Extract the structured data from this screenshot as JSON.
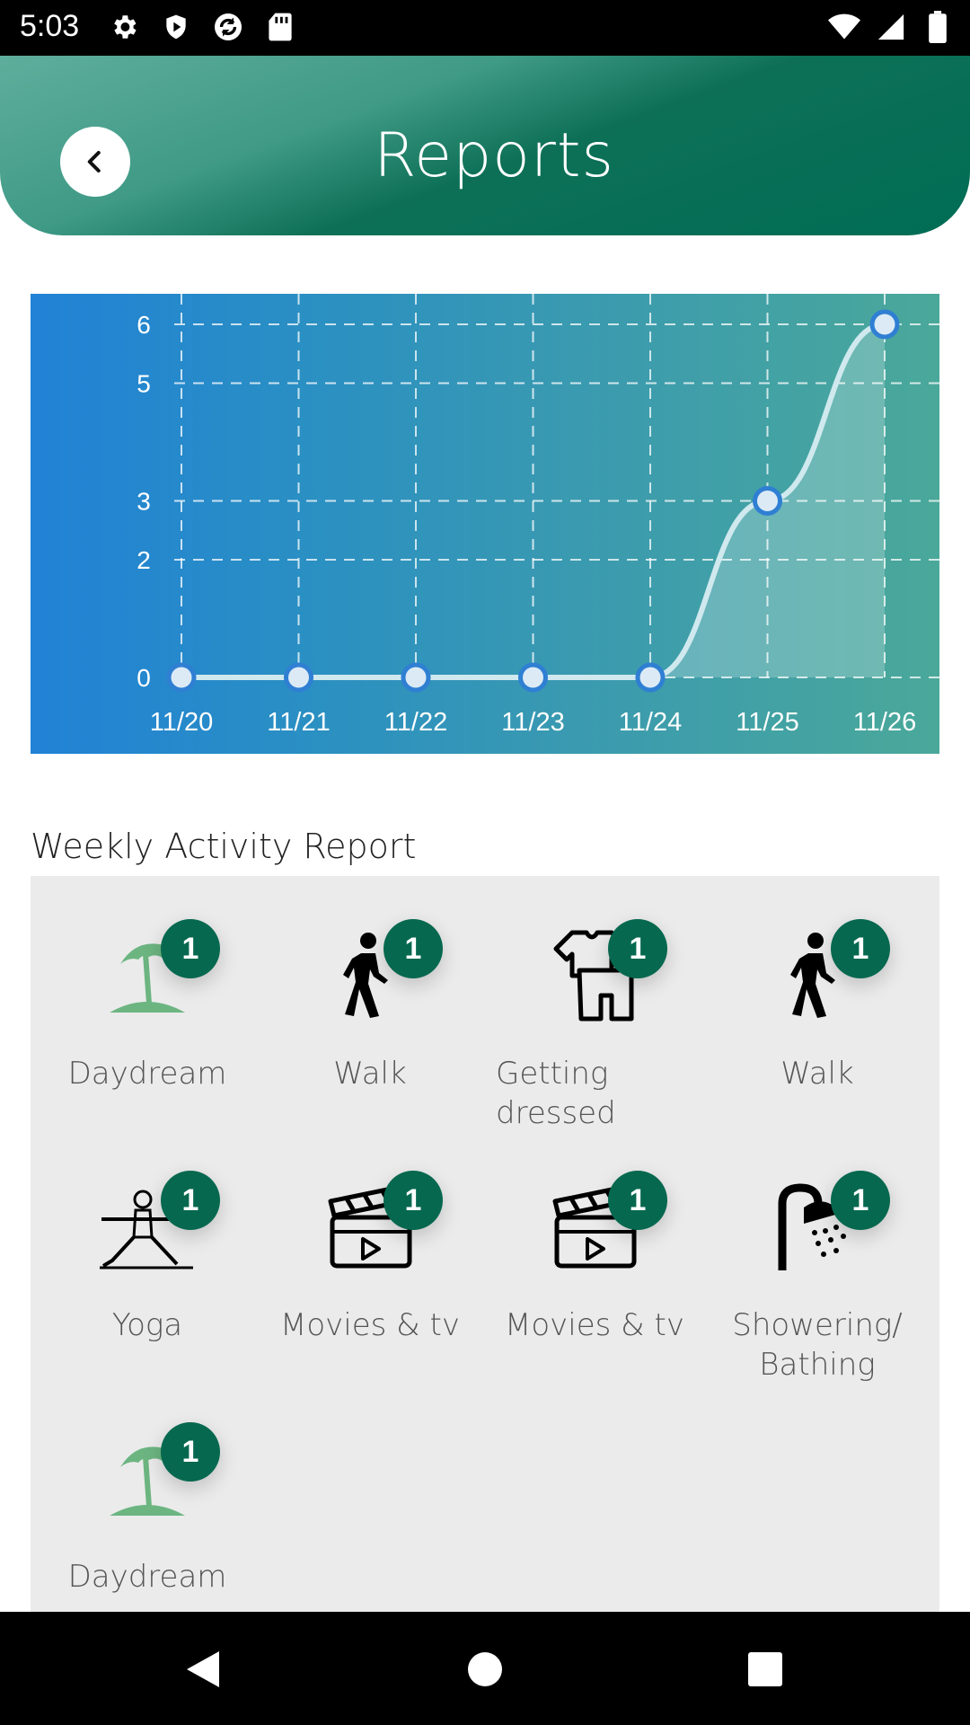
{
  "status_bar": {
    "time": "5:03",
    "icons_left": [
      "gear-icon",
      "shield-play-icon",
      "sync-icon",
      "sd-card-icon"
    ],
    "icons_right": [
      "wifi-icon",
      "signal-icon",
      "battery-icon"
    ]
  },
  "header": {
    "title": "Reports",
    "back_icon": "chevron-left-icon",
    "gradient_colors": [
      "#5fae9c",
      "#006d55"
    ]
  },
  "chart_data": {
    "type": "line",
    "x": [
      "11/20",
      "11/21",
      "11/22",
      "11/23",
      "11/24",
      "11/25",
      "11/26"
    ],
    "series": [
      {
        "values": [
          0,
          0,
          0,
          0,
          0,
          3,
          6
        ]
      }
    ],
    "yticks": [
      "6",
      "5",
      "3",
      "2",
      "0"
    ],
    "ylim": [
      0,
      6
    ],
    "grid": true,
    "smooth": true,
    "area_fill": true,
    "background_gradient": [
      "#2182d6",
      "#4aa89a"
    ],
    "line_color": "#cfe9ee",
    "marker_color": "#2f7fd3"
  },
  "weekly_report": {
    "title": "Weekly Activity Report",
    "items": [
      {
        "label": "Daydream",
        "count": "1",
        "icon": "beach-umbrella-icon"
      },
      {
        "label": "Walk",
        "count": "1",
        "icon": "walking-person-icon"
      },
      {
        "label": "Getting dressed",
        "count": "1",
        "icon": "clothes-icon"
      },
      {
        "label": "Walk",
        "count": "1",
        "icon": "walking-person-icon"
      },
      {
        "label": "Yoga",
        "count": "1",
        "icon": "yoga-pose-icon"
      },
      {
        "label": "Movies & tv",
        "count": "1",
        "icon": "clapperboard-icon"
      },
      {
        "label": "Movies & tv",
        "count": "1",
        "icon": "clapperboard-icon"
      },
      {
        "label": "Showering/ Bathing",
        "count": "1",
        "icon": "shower-icon"
      },
      {
        "label": "Daydream",
        "count": "1",
        "icon": "beach-umbrella-icon"
      }
    ],
    "badge_color": "#06684f"
  },
  "nav_bar": {
    "icons": [
      "back-triangle-icon",
      "home-circle-icon",
      "recents-square-icon"
    ]
  }
}
